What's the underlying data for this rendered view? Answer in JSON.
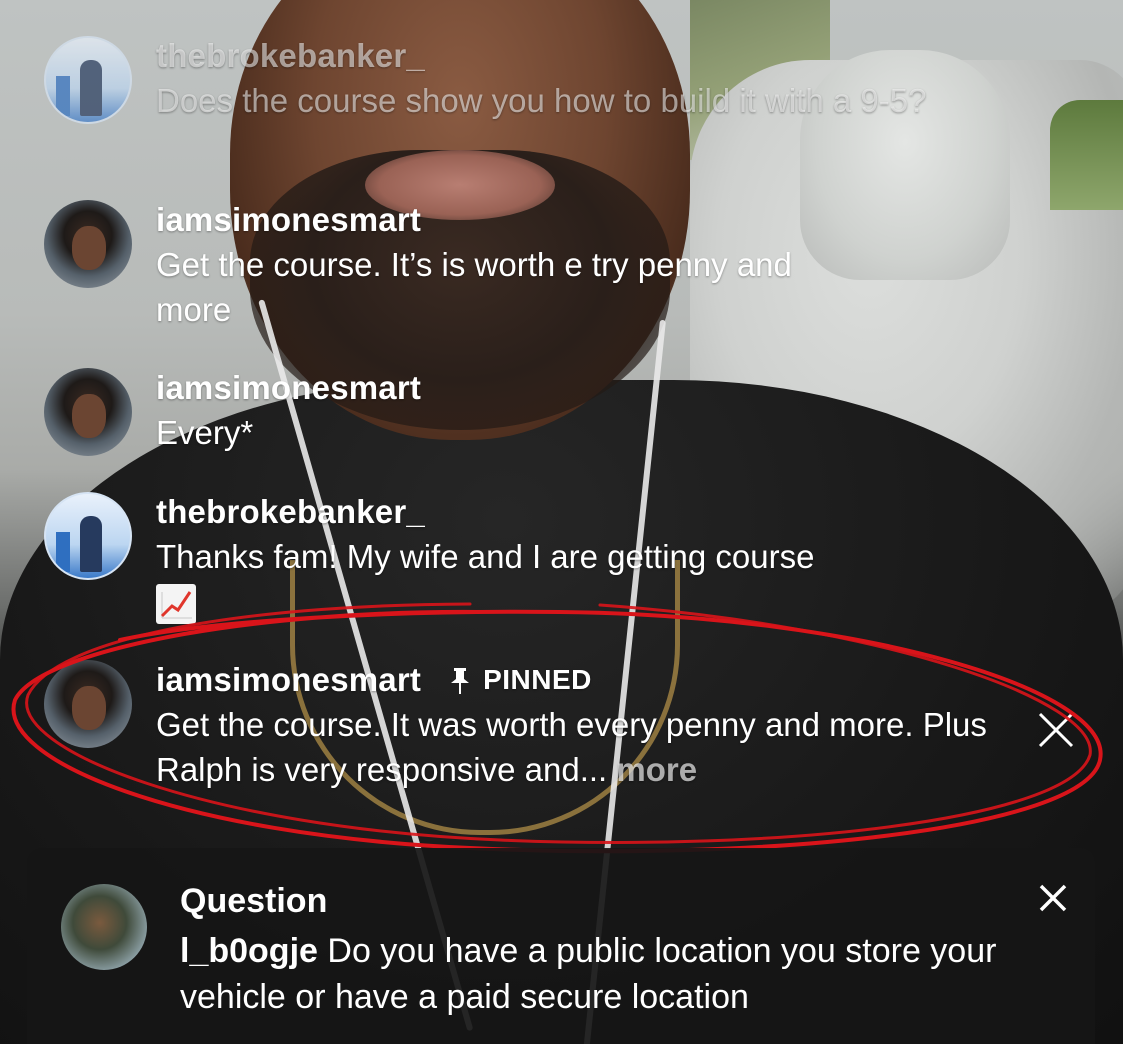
{
  "comments": [
    {
      "username": "thebrokebanker_",
      "message": "Does the course show you how to build it with a 9-5?",
      "avatar": "thebrokebanker-avatar"
    },
    {
      "username": "iamsimonesmart",
      "message": "Get the course. It’s is worth e try penny and more",
      "avatar": "iamsimonesmart-avatar"
    },
    {
      "username": "iamsimonesmart",
      "message": "Every*",
      "avatar": "iamsimonesmart-avatar"
    },
    {
      "username": "thebrokebanker_",
      "message": "Thanks fam! My wife and I are getting course",
      "emoji": "chart-increasing-emoji",
      "avatar": "thebrokebanker-avatar"
    }
  ],
  "pinned": {
    "username": "iamsimonesmart",
    "badge": "PINNED",
    "message": "Get the course. It was worth every penny and more. Plus Ralph is very responsive and...",
    "more_label": "more",
    "icon": "pin-icon"
  },
  "question": {
    "title": "Question",
    "username": "l_b0ogje",
    "text": "Do you have a public location you store your vehicle or have a paid secure location",
    "icon": "close-icon"
  },
  "colors": {
    "annotation": "#d9141a",
    "text": "#ffffff",
    "card_bg": "#161616"
  }
}
